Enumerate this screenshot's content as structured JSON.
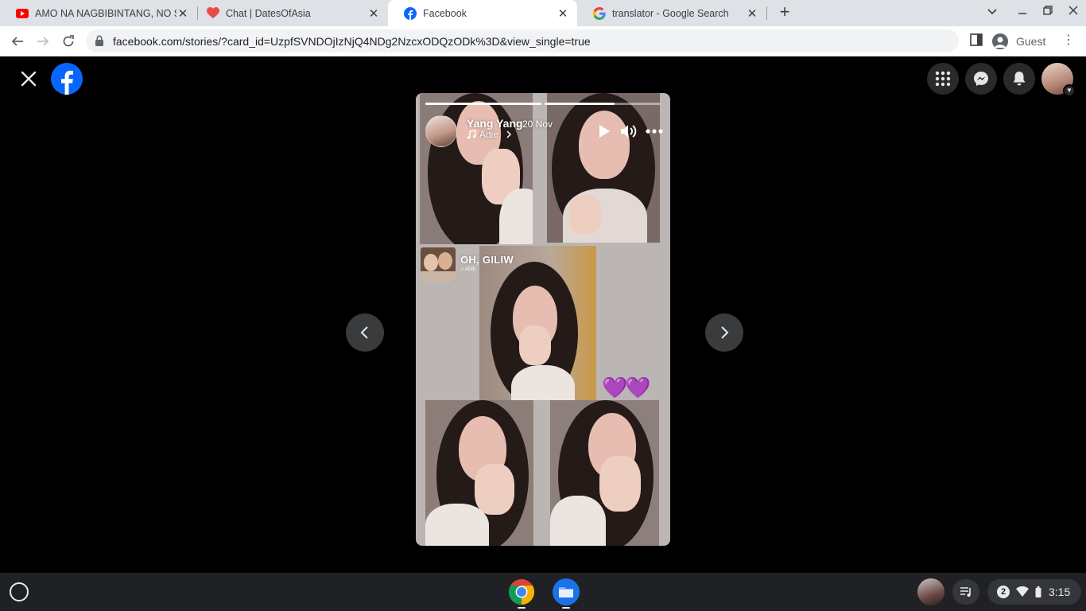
{
  "browser": {
    "tabs": [
      {
        "title": "AMO NA NAGBIBINTANG, NO SH",
        "icon": "youtube-icon",
        "active": false
      },
      {
        "title": "Chat | DatesOfAsia",
        "icon": "heart-icon",
        "active": false
      },
      {
        "title": "Facebook",
        "icon": "facebook-icon",
        "active": true
      },
      {
        "title": "translator - Google Search",
        "icon": "google-icon",
        "active": false
      }
    ],
    "url": "facebook.com/stories/?card_id=UzpfSVNDOjIzNjQ4NDg2NzcxODQzODk%3D&view_single=true",
    "profile_label": "Guest"
  },
  "story": {
    "user_name": "Yang Yang",
    "date": "20 Nov",
    "music_label": "Adie",
    "song_title": "OH, GILIW",
    "song_artist": "ADIE",
    "progress": [
      1.0,
      0.6
    ],
    "heart_emoji": "💜💜"
  },
  "shelf": {
    "notification_count": "2",
    "clock": "3:15"
  },
  "colors": {
    "facebook_blue": "#0866ff",
    "story_bg": "#bbb5b3",
    "shelf_bg": "#202124"
  }
}
